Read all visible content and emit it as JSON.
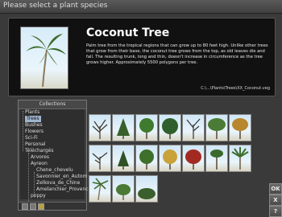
{
  "window": {
    "title": "Please select a plant species"
  },
  "species": {
    "name": "Coconut Tree",
    "description": "Palm tree from the tropical regions that can grow up to 80 feet high. Unlike other trees that grow from their base, the coconut tree grows from the top, as old leaves die and fall. The resulting trunk, long and thin, doesn't increase in circumference as the tree grows higher. Approximately 5500 polygons per tree.",
    "path": "C:\\...\\Plants\\Trees\\XX_Coconut.veg"
  },
  "collections": {
    "header": "Collections",
    "items": [
      {
        "label": "Plants"
      },
      {
        "label": "Trees"
      },
      {
        "label": "Bushes"
      },
      {
        "label": "Flowers"
      },
      {
        "label": "Sci-Fi"
      },
      {
        "label": "Personal"
      },
      {
        "label": "Téléchargés"
      },
      {
        "label": "Arvores"
      },
      {
        "label": "Ayreon"
      },
      {
        "label": "Chene_chevelu"
      },
      {
        "label": "Savonnier_en_Autom"
      },
      {
        "label": "Zelkova_de_Chine"
      },
      {
        "label": "Amelanchier_Provenc"
      },
      {
        "label": "poppy"
      }
    ]
  },
  "thumbnails": [
    "bare-tree",
    "conifer",
    "broadleaf-green",
    "broadleaf-dense",
    "bare-tree-dark",
    "broadleaf-round",
    "autumn-tree",
    "bare-branches",
    "small-conifer",
    "leafy-tree",
    "autumn-yellow",
    "red-maple",
    "pine-tall",
    "palm-fan",
    "coconut-palm",
    "small-bush",
    "flat-bush"
  ],
  "buttons": {
    "ok": "OK",
    "cancel": "X",
    "help": "?"
  }
}
